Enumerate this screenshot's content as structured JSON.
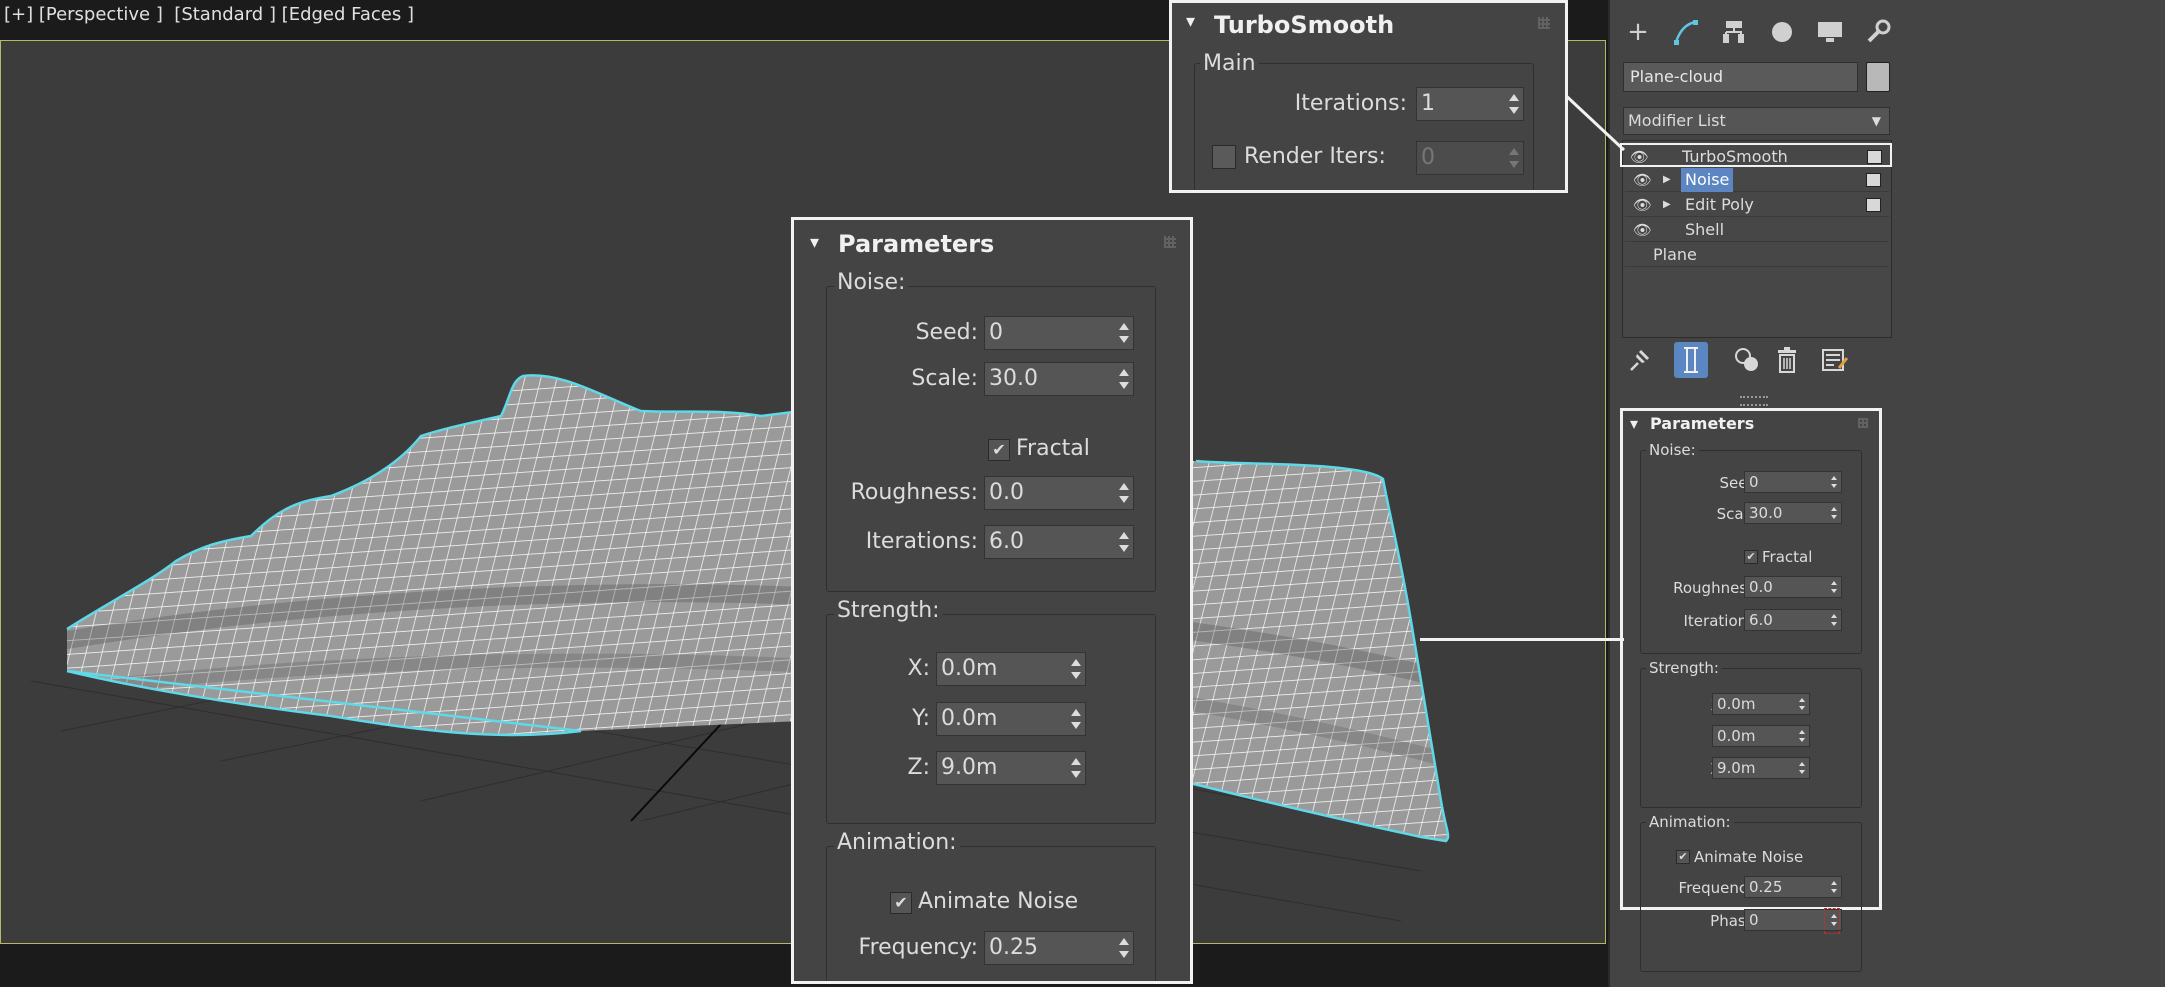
{
  "viewport": {
    "label": "[+] [Perspective ]  [Standard ] [Edged Faces ]"
  },
  "command_panel": {
    "tabs": [
      "create-icon",
      "modify-icon",
      "hierarchy-icon",
      "motion-icon",
      "display-icon",
      "utilities-icon"
    ],
    "object_name": "Plane-cloud",
    "modifier_list": "Modifier List",
    "stack": [
      {
        "label": "TurboSmooth",
        "eye": "👁",
        "selected": false,
        "expand": false,
        "box": true
      },
      {
        "label": "Noise",
        "eye": "👁",
        "selected": true,
        "expand": true,
        "box": true
      },
      {
        "label": "Edit Poly",
        "eye": "👁",
        "selected": false,
        "expand": true,
        "box": true
      },
      {
        "label": "Shell",
        "eye": "👁",
        "selected": false,
        "expand": false,
        "box": false
      },
      {
        "label": "Plane",
        "eye": "",
        "selected": false,
        "expand": false,
        "box": false
      }
    ],
    "stack_tools": [
      "pin-stack-icon",
      "show-end-result-icon",
      "make-unique-icon",
      "remove-modifier-icon",
      "configure-sets-icon"
    ],
    "parameters": {
      "title": "Parameters",
      "noise_group": "Noise:",
      "seed_label": "Seed:",
      "seed": "0",
      "scale_label": "Scale:",
      "scale": "30.0",
      "fractal_label": "Fractal",
      "fractal_checked": true,
      "roughness_label": "Roughness:",
      "roughness": "0.0",
      "iterations_label": "Iterations:",
      "iterations": "6.0",
      "strength_group": "Strength:",
      "x_label": "X:",
      "x": "0.0m",
      "y_label": "Y:",
      "y": "0.0m",
      "z_label": "Z:",
      "z": "9.0m",
      "animation_group": "Animation:",
      "animate_noise_label": "Animate Noise",
      "animate_noise_checked": true,
      "frequency_label": "Frequency:",
      "frequency": "0.25",
      "phase_label": "Phase:",
      "phase": "0"
    }
  },
  "turbosmooth_zoom": {
    "title": "TurboSmooth",
    "main_group": "Main",
    "iterations_label": "Iterations:",
    "iterations": "1",
    "render_iters_label": "Render Iters:",
    "render_iters": "0"
  },
  "colors": {
    "viewport_bg": "#3c3c3c",
    "selection_cyan": "#5fd8e8",
    "selected_row": "#5b86c2",
    "panel_bg": "#444444"
  }
}
